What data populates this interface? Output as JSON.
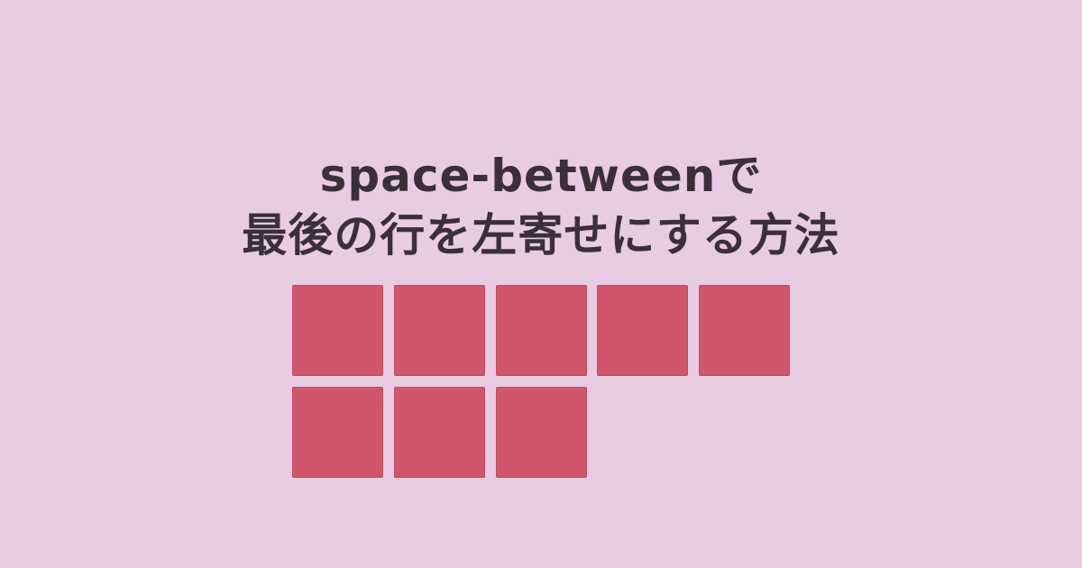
{
  "title": {
    "line1": "space-betweenで",
    "line2": "最後の行を左寄せにする方法"
  },
  "grid": {
    "columns": 5,
    "tile_count": 8,
    "tile_color": "#d0566c",
    "background_color": "#e8cce3",
    "text_color": "#3a2f3a"
  }
}
